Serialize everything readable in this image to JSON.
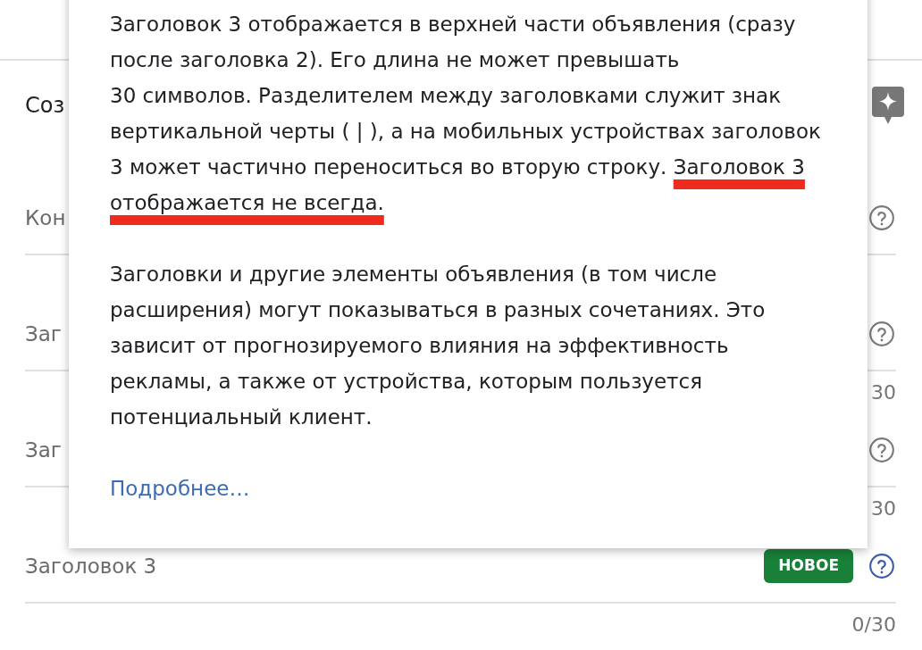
{
  "section": {
    "title": "Соз"
  },
  "fields": [
    {
      "kind": "input",
      "placeholder": "Кон",
      "help_active": false
    },
    {
      "kind": "input",
      "placeholder": "Заг",
      "help_active": false,
      "counter": "30"
    },
    {
      "kind": "input",
      "placeholder": "Заг",
      "help_active": false,
      "counter": "30"
    },
    {
      "kind": "input",
      "placeholder": "Заголовок 3",
      "badge": "НОВОЕ",
      "help_active": true,
      "counter": "0/30"
    }
  ],
  "tooltip": {
    "paragraphs": [
      {
        "text": "Заголовок 3 отображается в верхней части объявления (сразу после заголовка 2). Его длина не может превышать 30 символов. Разделителем между заголовками служит знак вертикальной черты ( | ), а на мобильных устройствах заголовок 3 может частично переноситься во вторую строку.",
        "underlined": "Заголовок 3 отображается не всегда."
      },
      {
        "text": "Заголовки и другие элементы объявления (в том числе расширения) могут показываться в разных сочетаниях. Это зависит от прогнозируемого влияния на эффективность рекламы, а также от устройства, которым пользуется потенциальный клиент."
      }
    ],
    "link": "Подробнее…"
  }
}
